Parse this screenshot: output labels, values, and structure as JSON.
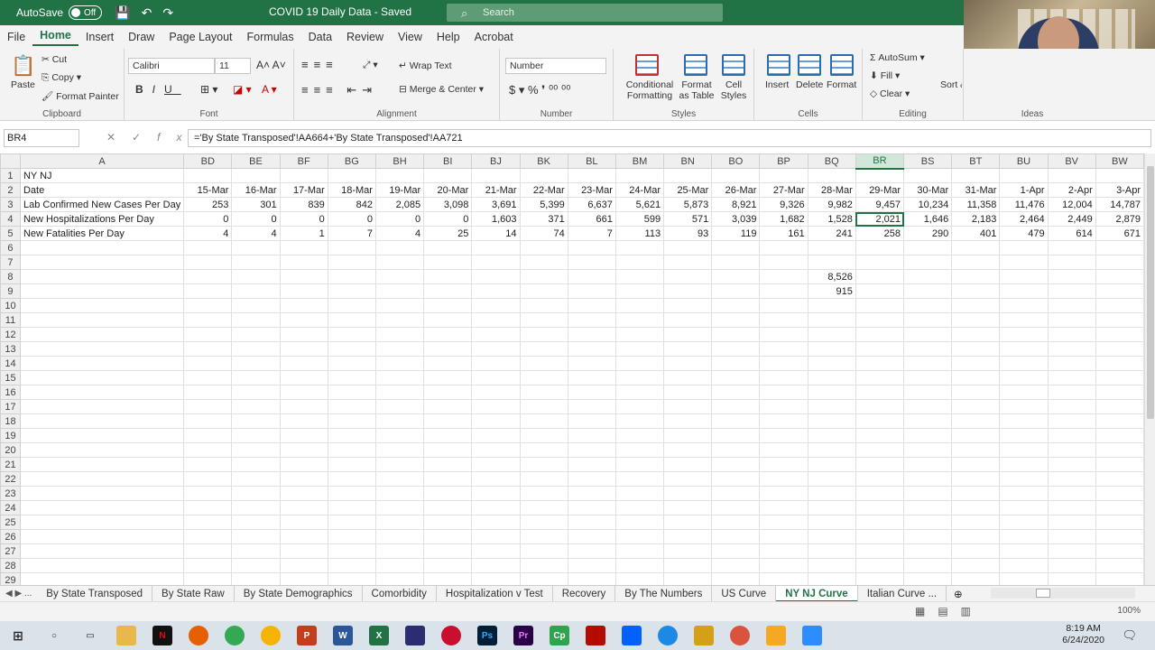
{
  "titlebar": {
    "autosave": "AutoSave",
    "autosave_state": "Off",
    "doc_title": "COVID 19 Daily Data  -  Saved",
    "search_placeholder": "Search"
  },
  "menu": [
    "File",
    "Home",
    "Insert",
    "Draw",
    "Page Layout",
    "Formulas",
    "Data",
    "Review",
    "View",
    "Help",
    "Acrobat"
  ],
  "active_menu": "Home",
  "ribbon": {
    "clipboard": {
      "label": "Clipboard",
      "paste": "Paste",
      "cut": "Cut",
      "copy": "Copy",
      "format_painter": "Format Painter"
    },
    "font": {
      "label": "Font",
      "family": "Calibri",
      "size": "11"
    },
    "alignment": {
      "label": "Alignment",
      "wrap": "Wrap Text",
      "merge": "Merge & Center"
    },
    "number": {
      "label": "Number",
      "format": "Number"
    },
    "styles": {
      "label": "Styles",
      "conditional": "Conditional Formatting",
      "format_table": "Format as Table",
      "cell_styles": "Cell Styles"
    },
    "cells": {
      "label": "Cells",
      "insert": "Insert",
      "delete": "Delete",
      "format": "Format"
    },
    "editing": {
      "label": "Editing",
      "autosum": "AutoSum",
      "fill": "Fill",
      "clear": "Clear",
      "sort": "Sort & Filter"
    },
    "ideas": {
      "label": "Ideas"
    }
  },
  "formula_bar": {
    "name_box": "BR4",
    "formula": "='By State Transposed'!AA664+'By State Transposed'!AA721"
  },
  "columns": [
    "A",
    "BD",
    "BE",
    "BF",
    "BG",
    "BH",
    "BI",
    "BJ",
    "BK",
    "BL",
    "BM",
    "BN",
    "BO",
    "BP",
    "BQ",
    "BR",
    "BS",
    "BT",
    "BU",
    "BV",
    "BW"
  ],
  "selected_column": "BR",
  "sheet": {
    "r1": {
      "label": "NY NJ"
    },
    "r2": {
      "label": "Date",
      "values": [
        "15-Mar",
        "16-Mar",
        "17-Mar",
        "18-Mar",
        "19-Mar",
        "20-Mar",
        "21-Mar",
        "22-Mar",
        "23-Mar",
        "24-Mar",
        "25-Mar",
        "26-Mar",
        "27-Mar",
        "28-Mar",
        "29-Mar",
        "30-Mar",
        "31-Mar",
        "1-Apr",
        "2-Apr",
        "3-Apr"
      ]
    },
    "r3": {
      "label": "Lab Confirmed New Cases Per Day",
      "values": [
        "253",
        "301",
        "839",
        "842",
        "2,085",
        "3,098",
        "3,691",
        "5,399",
        "6,637",
        "5,621",
        "5,873",
        "8,921",
        "9,326",
        "9,982",
        "9,457",
        "10,234",
        "11,358",
        "11,476",
        "12,004",
        "14,787"
      ]
    },
    "r4": {
      "label": "New Hospitalizations Per Day",
      "values": [
        "0",
        "0",
        "0",
        "0",
        "0",
        "0",
        "1,603",
        "371",
        "661",
        "599",
        "571",
        "3,039",
        "1,682",
        "1,528",
        "2,021",
        "1,646",
        "2,183",
        "2,464",
        "2,449",
        "2,879"
      ]
    },
    "r5": {
      "label": "New Fatalities Per Day",
      "values": [
        "4",
        "4",
        "1",
        "7",
        "4",
        "25",
        "14",
        "74",
        "7",
        "113",
        "93",
        "119",
        "161",
        "241",
        "258",
        "290",
        "401",
        "479",
        "614",
        "671"
      ]
    },
    "r8_bq": "8,526",
    "r9_bq": "915"
  },
  "row_numbers": [
    "1",
    "2",
    "3",
    "4",
    "5",
    "6",
    "7",
    "8",
    "9",
    "10",
    "11",
    "12",
    "13",
    "14",
    "15",
    "16",
    "17",
    "18",
    "19",
    "20",
    "21",
    "22",
    "23",
    "24",
    "25",
    "26",
    "27",
    "28",
    "29"
  ],
  "tabs": [
    "By State Transposed",
    "By State Raw",
    "By State Demographics",
    "Comorbidity",
    "Hospitalization v Test",
    "Recovery",
    "By The Numbers",
    "US Curve",
    "NY NJ Curve",
    "Italian Curve ..."
  ],
  "active_tab": "NY NJ Curve",
  "status": {
    "zoom": "100%"
  },
  "taskbar": {
    "time": "8:19 AM",
    "date": "6/24/2020"
  }
}
